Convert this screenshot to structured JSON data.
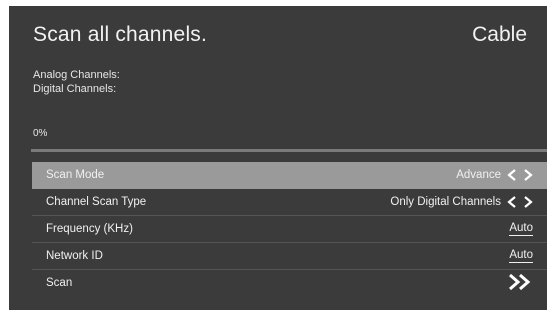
{
  "header": {
    "title": "Scan all channels.",
    "source": "Cable"
  },
  "info": {
    "analog_label": "Analog Channels:",
    "digital_label": "Digital Channels:"
  },
  "progress": {
    "text": "0%",
    "value": 0
  },
  "menu": {
    "scan_mode": {
      "label": "Scan Mode",
      "value": "Advance"
    },
    "channel_scan_type": {
      "label": "Channel Scan Type",
      "value": "Only Digital Channels"
    },
    "frequency": {
      "label": "Frequency (KHz)",
      "value": "Auto"
    },
    "network_id": {
      "label": "Network ID",
      "value": "Auto"
    },
    "scan": {
      "label": "Scan"
    }
  },
  "icons": {
    "left_right": "left-right-arrows-icon",
    "forward": "double-chevron-right-icon"
  },
  "colors": {
    "background": "#3b3b3b",
    "selected_row": "#9a9a9a",
    "text": "#f0f0f0"
  }
}
